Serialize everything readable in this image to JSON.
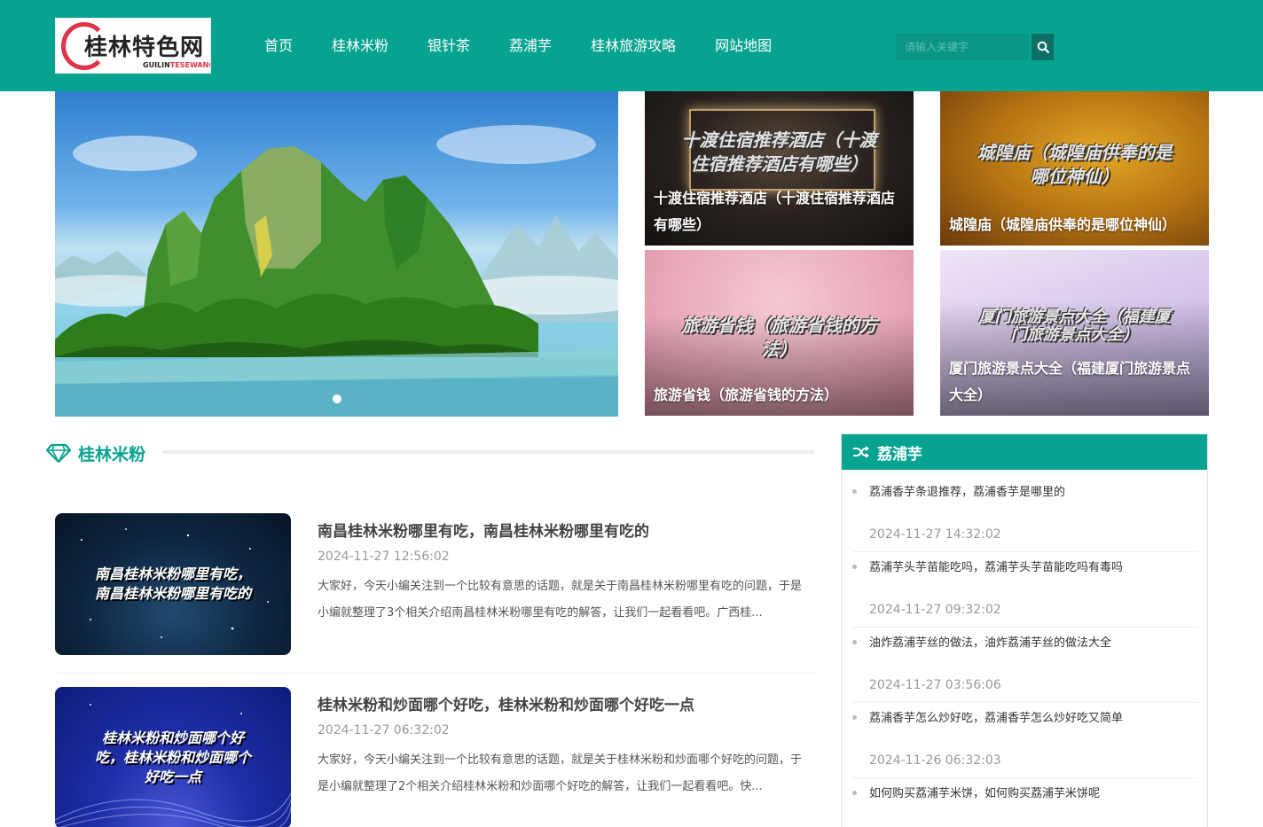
{
  "header": {
    "logo_title": "桂林特色网",
    "logo_sub_a": "GUILIN",
    "logo_sub_b": "TESEWANG",
    "nav": [
      "首页",
      "桂林米粉",
      "银针茶",
      "荔浦芋",
      "桂林旅游攻略",
      "网站地图"
    ],
    "search_placeholder": "请输入关键字"
  },
  "colors": {
    "brand": "#06a390",
    "header_bg": "#06a390",
    "logo_accent": "#e0334a"
  },
  "slider": {
    "active_slide": 1,
    "slide_count": 1
  },
  "featured": [
    {
      "image_text": "十渡住宿推荐酒店（十渡住宿推荐酒店有哪些）",
      "caption": "十渡住宿推荐酒店（十渡住宿推荐酒店有哪些）"
    },
    {
      "image_text": "城隍庙（城隍庙供奉的是哪位神仙）",
      "caption": "城隍庙（城隍庙供奉的是哪位神仙）"
    },
    {
      "image_text": "旅游省钱（旅游省钱的方法）",
      "caption": "旅游省钱（旅游省钱的方法）"
    },
    {
      "image_text": "厦门旅游景点大全（福建厦门旅游景点大全）",
      "caption": "厦门旅游景点大全（福建厦门旅游景点大全）"
    }
  ],
  "section": {
    "title": "桂林米粉",
    "icon": "diamond-icon",
    "posts": [
      {
        "thumb_text": "南昌桂林米粉哪里有吃，南昌桂林米粉哪里有吃的",
        "title": "南昌桂林米粉哪里有吃，南昌桂林米粉哪里有吃的",
        "date": "2024-11-27 12:56:02",
        "desc": "大家好，今天小编关注到一个比较有意思的话题，就是关于南昌桂林米粉哪里有吃的问题，于是小编就整理了3个相关介绍南昌桂林米粉哪里有吃的解答，让我们一起看看吧。广西桂..."
      },
      {
        "thumb_text": "桂林米粉和炒面哪个好吃，桂林米粉和炒面哪个好吃一点",
        "title": "桂林米粉和炒面哪个好吃，桂林米粉和炒面哪个好吃一点",
        "date": "2024-11-27 06:32:02",
        "desc": "大家好，今天小编关注到一个比较有意思的话题，就是关于桂林米粉和炒面哪个好吃的问题，于是小编就整理了2个相关介绍桂林米粉和炒面哪个好吃的解答，让我们一起看看吧。快..."
      }
    ]
  },
  "sidebar": {
    "title": "荔浦芋",
    "icon": "shuffle-icon",
    "items": [
      {
        "title": "荔浦香芋条退推荐，荔浦香芋是哪里的",
        "date": "2024-11-27 14:32:02"
      },
      {
        "title": "荔浦芋头芋苗能吃吗，荔浦芋头芋苗能吃吗有毒吗",
        "date": "2024-11-27 09:32:02"
      },
      {
        "title": "油炸荔浦芋丝的做法，油炸荔浦芋丝的做法大全",
        "date": "2024-11-27 03:56:06"
      },
      {
        "title": "荔浦香芋怎么炒好吃，荔浦香芋怎么炒好吃又简单",
        "date": "2024-11-26 06:32:03"
      },
      {
        "title": "如何购买荔浦芋米饼，如何购买荔浦芋米饼呢",
        "date": ""
      }
    ]
  }
}
